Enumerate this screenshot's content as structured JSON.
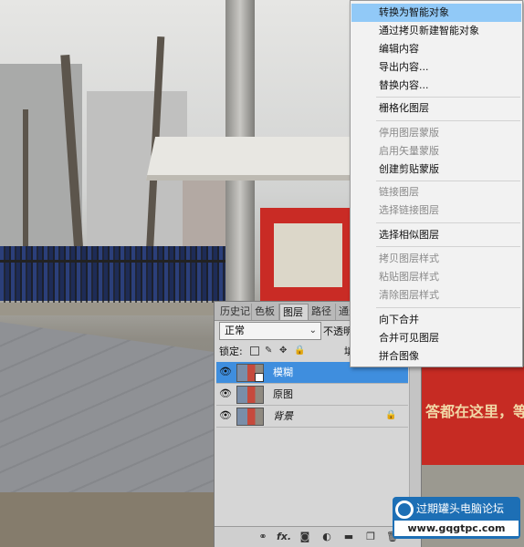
{
  "context_menu": {
    "items": [
      {
        "label": "转换为智能对象",
        "state": "highlighted"
      },
      {
        "label": "通过拷贝新建智能对象",
        "state": "enabled"
      },
      {
        "label": "编辑内容",
        "state": "enabled"
      },
      {
        "label": "导出内容...",
        "state": "enabled"
      },
      {
        "label": "替换内容...",
        "state": "enabled"
      },
      {
        "label": "栅格化图层",
        "state": "enabled"
      },
      {
        "label": "停用图层蒙版",
        "state": "disabled"
      },
      {
        "label": "启用矢量蒙版",
        "state": "disabled"
      },
      {
        "label": "创建剪贴蒙版",
        "state": "enabled"
      },
      {
        "label": "链接图层",
        "state": "disabled"
      },
      {
        "label": "选择链接图层",
        "state": "disabled"
      },
      {
        "label": "选择相似图层",
        "state": "enabled"
      },
      {
        "label": "拷贝图层样式",
        "state": "disabled"
      },
      {
        "label": "粘贴图层样式",
        "state": "disabled"
      },
      {
        "label": "清除图层样式",
        "state": "disabled"
      },
      {
        "label": "向下合并",
        "state": "enabled"
      },
      {
        "label": "合并可见图层",
        "state": "enabled"
      },
      {
        "label": "拼合图像",
        "state": "enabled"
      }
    ]
  },
  "layers_panel": {
    "tabs": [
      "历史记",
      "色板",
      "图层",
      "路径",
      "通道"
    ],
    "active_tab": "图层",
    "blend_mode": "正常",
    "opacity_label": "不透明",
    "lock_label": "锁定:",
    "fill_label": "填",
    "layers": [
      {
        "name": "模糊",
        "selected": true,
        "visible": true,
        "locked": false,
        "italic": false
      },
      {
        "name": "原图",
        "selected": false,
        "visible": true,
        "locked": false,
        "italic": false
      },
      {
        "name": "背景",
        "selected": false,
        "visible": true,
        "locked": true,
        "italic": true
      }
    ],
    "bottom_icons": [
      "link-icon",
      "fx-icon",
      "mask-icon",
      "adjustment-icon",
      "folder-icon",
      "new-layer-icon",
      "trash-icon"
    ],
    "fx_label": "fx."
  },
  "background_sign_text": "答都在这里，等",
  "watermark": {
    "title": "过期罐头电脑论坛",
    "url": "www.gqgtpc.com"
  },
  "colors": {
    "menu_highlight": "#91c9f7",
    "layer_selected": "#3f8ede",
    "watermark_blue": "#1d6fb5"
  }
}
